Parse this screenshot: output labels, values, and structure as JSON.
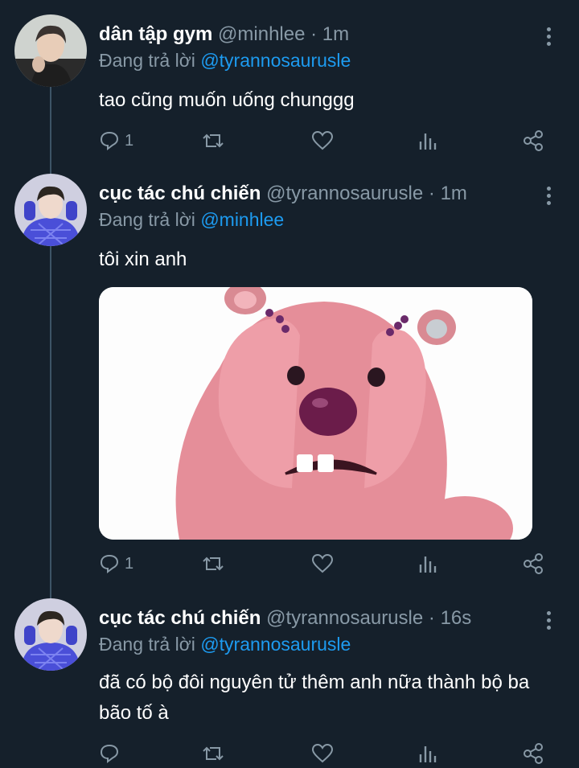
{
  "tweets": [
    {
      "name": "dân tập gym",
      "handle": "@minhlee",
      "sep": "·",
      "time": "1m",
      "reply_prefix": "Đang trả lời",
      "reply_to": "@tyrannosaurusle",
      "text": "tao cũng muốn uống chunggg",
      "reply_count": "1",
      "avatar_icon": "avatar-photo-icon"
    },
    {
      "name": "cục tác chú chiến",
      "handle": "@tyrannosaurusle",
      "sep": "·",
      "time": "1m",
      "reply_prefix": "Đang trả lời",
      "reply_to": "@minhlee",
      "text": "tôi xin anh",
      "reply_count": "1",
      "avatar_icon": "avatar-photo-icon",
      "media_icon": "pink-beaver-sticker-icon"
    },
    {
      "name": "cục tác chú chiến",
      "handle": "@tyrannosaurusle",
      "sep": "·",
      "time": "16s",
      "reply_prefix": "Đang trả lời",
      "reply_to": "@tyrannosaurusle",
      "text": "đã có bộ đôi nguyên tử thêm anh nữa thành bộ ba bão tố à",
      "reply_count": "",
      "avatar_icon": "avatar-photo-icon"
    }
  ],
  "icons": {
    "reply": "reply-icon",
    "retweet": "retweet-icon",
    "like": "heart-icon",
    "analytics": "analytics-icon",
    "share": "share-icon",
    "more": "more-options-icon"
  },
  "colors": {
    "background": "#15202b",
    "secondary_text": "#8899a6",
    "accent": "#1d9bf0",
    "thread_line": "#3d5466"
  }
}
